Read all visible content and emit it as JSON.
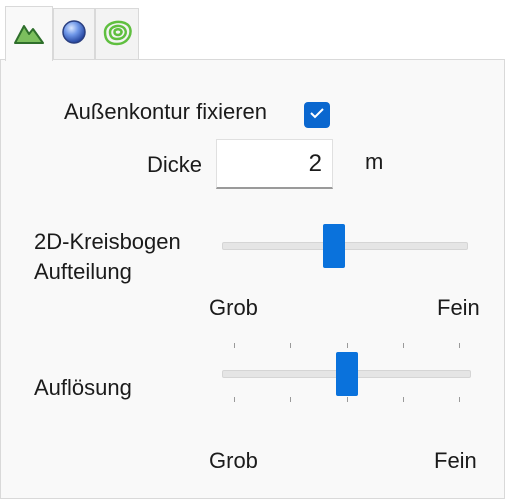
{
  "tabs": [
    {
      "name": "terrain-mountain-icon",
      "active": true
    },
    {
      "name": "sphere-icon",
      "active": false
    },
    {
      "name": "contour-lines-icon",
      "active": false
    }
  ],
  "fix_outline": {
    "label": "Außenkontur fixieren",
    "checked": true
  },
  "thickness": {
    "label": "Dicke",
    "value": "2",
    "unit": "m"
  },
  "arc_division": {
    "label_line1": "2D-Kreisbogen",
    "label_line2": "Aufteilung",
    "level": 0.45,
    "min_label": "Grob",
    "max_label": "Fein"
  },
  "resolution": {
    "label": "Auflösung",
    "level": 0.5,
    "ticks": 5,
    "min_label": "Grob",
    "max_label": "Fein"
  },
  "colors": {
    "accent": "#0a72dc",
    "terrain": "#3e8a3a",
    "sphere": "#3a62c8",
    "contour": "#5fbf3f"
  }
}
